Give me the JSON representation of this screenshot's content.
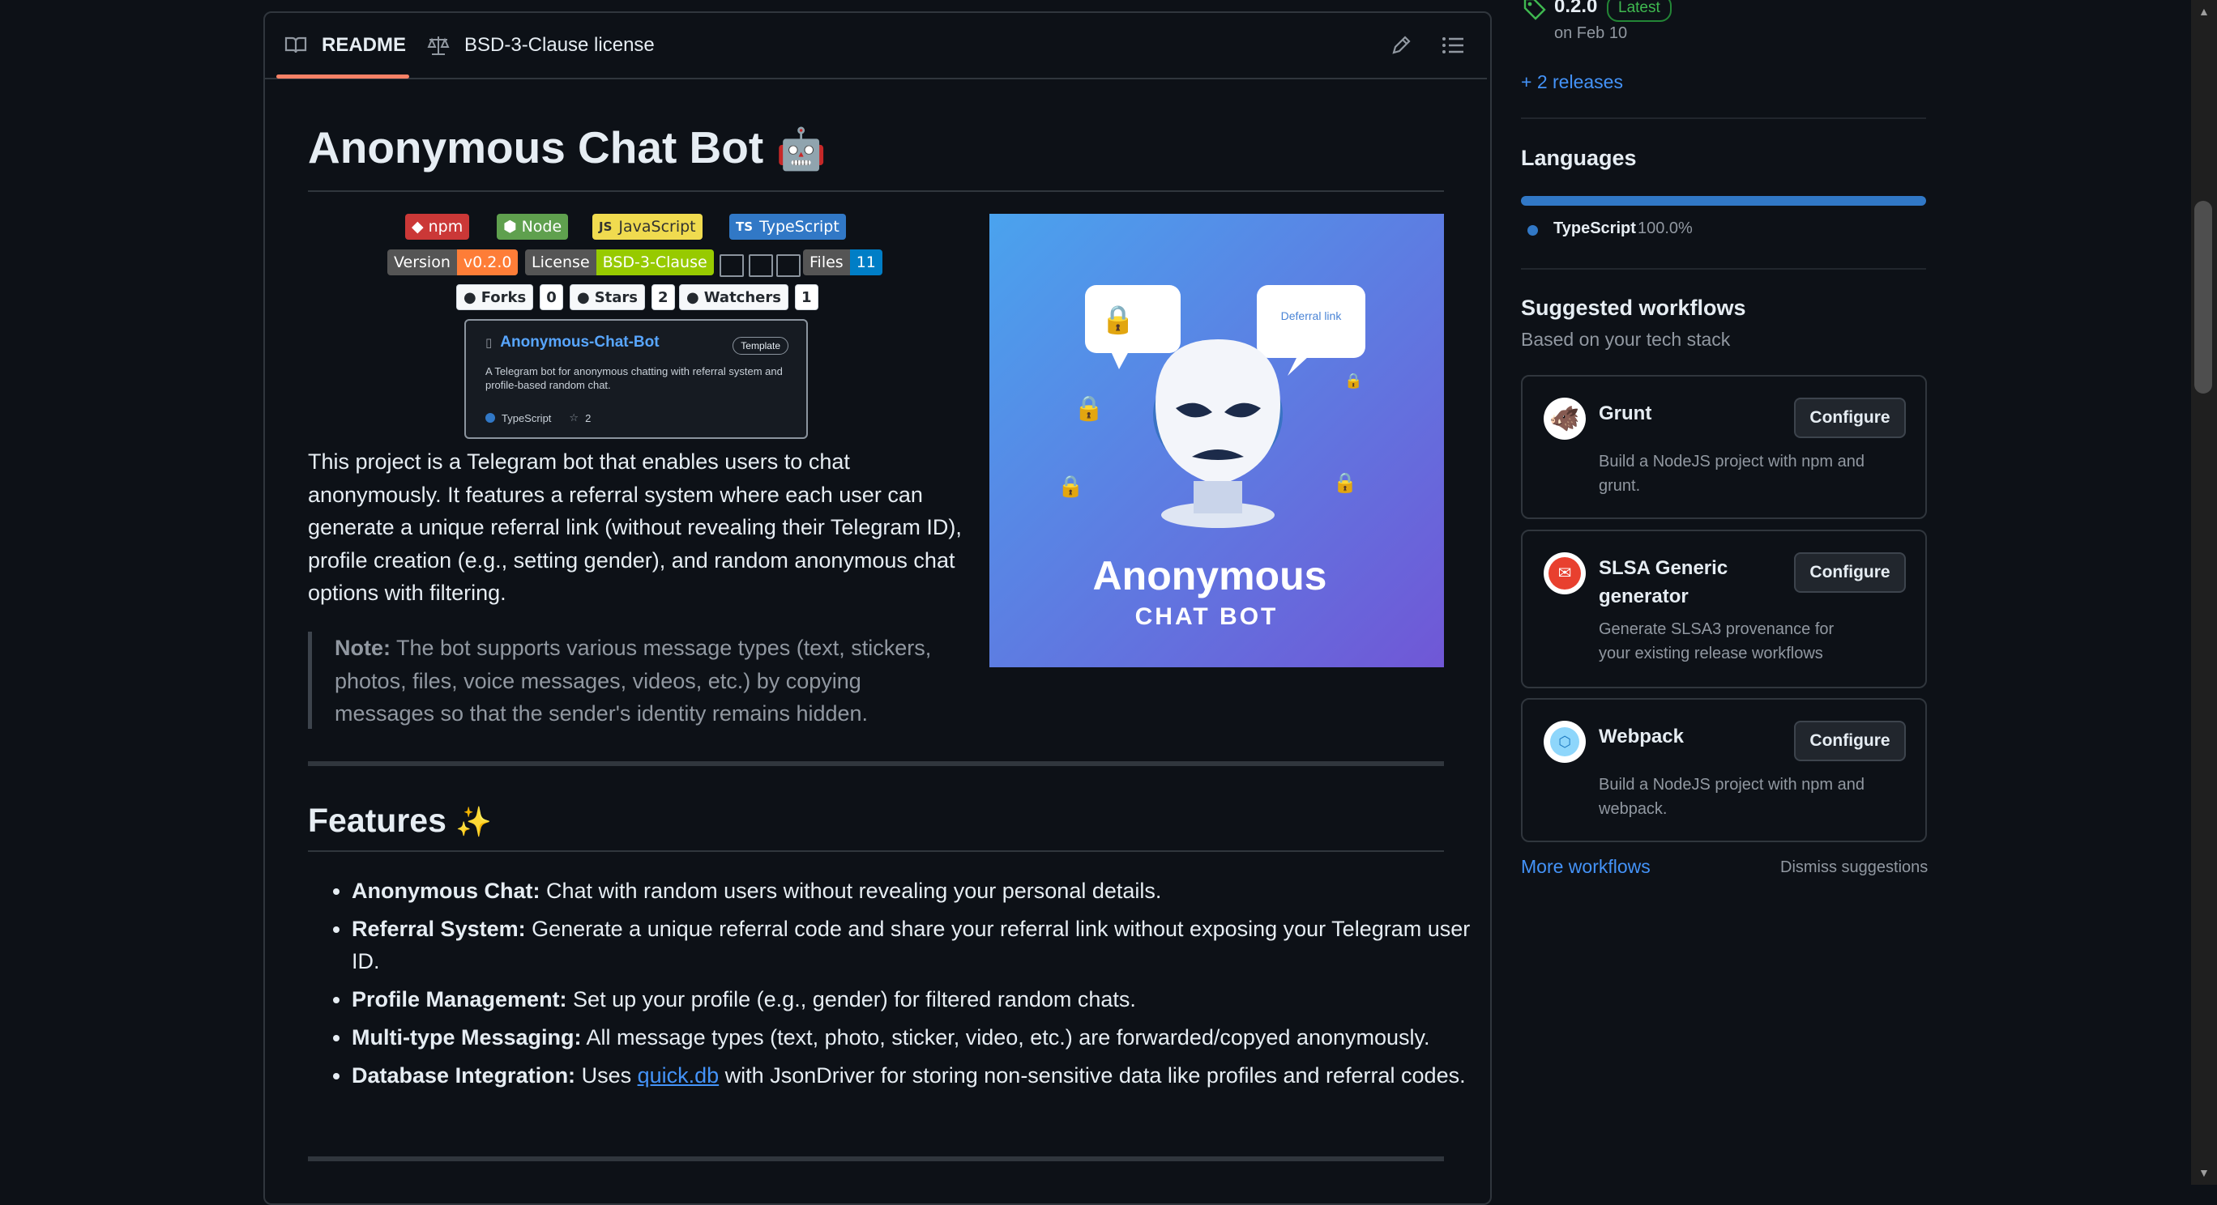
{
  "tabs": {
    "readme": "README",
    "license": "BSD-3-Clause license"
  },
  "title": "Anonymous Chat Bot",
  "title_emoji": "🤖",
  "badges": {
    "npm": "npm",
    "node": "Node",
    "js": "JavaScript",
    "ts": "TypeScript",
    "version_label": "Version",
    "version_value": "v0.2.0",
    "license_label": "License",
    "license_value": "BSD-3-Clause",
    "files_label": "Files",
    "files_value": "11",
    "forks_label": "Forks",
    "forks_value": "0",
    "stars_label": "Stars",
    "stars_value": "2",
    "watchers_label": "Watchers",
    "watchers_value": "1"
  },
  "repo_card": {
    "name": "Anonymous-Chat-Bot",
    "tag": "Template",
    "description": "A Telegram bot for anonymous chatting with referral system and profile-based random chat.",
    "language": "TypeScript",
    "stars": "2"
  },
  "intro": "This project is a Telegram bot that enables users to chat anonymously. It features a referral system where each user can generate a unique referral link (without revealing their Telegram ID), profile creation (e.g., setting gender), and random anonymous chat options with filtering.",
  "note": {
    "label": "Note:",
    "text": " The bot supports various message types (text, stickers, photos, files, voice messages, videos, etc.) by copying messages so that the sender's identity remains hidden."
  },
  "hero": {
    "line1": "Anonymous",
    "line2": "CHAT BOT",
    "bubble_text": "Deferral link"
  },
  "features": {
    "heading": "Features",
    "emoji": "✨",
    "items": [
      {
        "bold": "Anonymous Chat:",
        "text": " Chat with random users without revealing your personal details."
      },
      {
        "bold": "Referral System:",
        "text": " Generate a unique referral code and share your referral link without exposing your Telegram user ID."
      },
      {
        "bold": "Profile Management:",
        "text": " Set up your profile (e.g., gender) for filtered random chats."
      },
      {
        "bold": "Multi-type Messaging:",
        "text": " All message types (text, photo, sticker, video, etc.) are forwarded/copyed anonymously."
      },
      {
        "bold": "Database Integration:",
        "pre": " Uses ",
        "link": "quick.db",
        "text": " with JsonDriver for storing non-sensitive data like profiles and referral codes."
      }
    ]
  },
  "sidebar": {
    "release_version": "0.2.0",
    "release_badge": "Latest",
    "release_date": "on Feb 10",
    "more_releases": "+ 2 releases",
    "languages_heading": "Languages",
    "language_name": "TypeScript",
    "language_pct": "100.0%",
    "language_share": 1.0,
    "workflows_heading": "Suggested workflows",
    "workflows_sub": "Based on your tech stack",
    "workflows": [
      {
        "name": "Grunt",
        "desc": "Build a NodeJS project with npm and grunt.",
        "button": "Configure"
      },
      {
        "name": "SLSA Generic generator",
        "desc": "Generate SLSA3 provenance for your existing release workflows",
        "button": "Configure"
      },
      {
        "name": "Webpack",
        "desc": "Build a NodeJS project with npm and webpack.",
        "button": "Configure"
      }
    ],
    "more_workflows": "More workflows",
    "dismiss": "Dismiss suggestions"
  },
  "colors": {
    "accent": "#4493f8",
    "tab_underline": "#f78166",
    "ts_language": "#3178c6",
    "latest": "#3fb950"
  }
}
